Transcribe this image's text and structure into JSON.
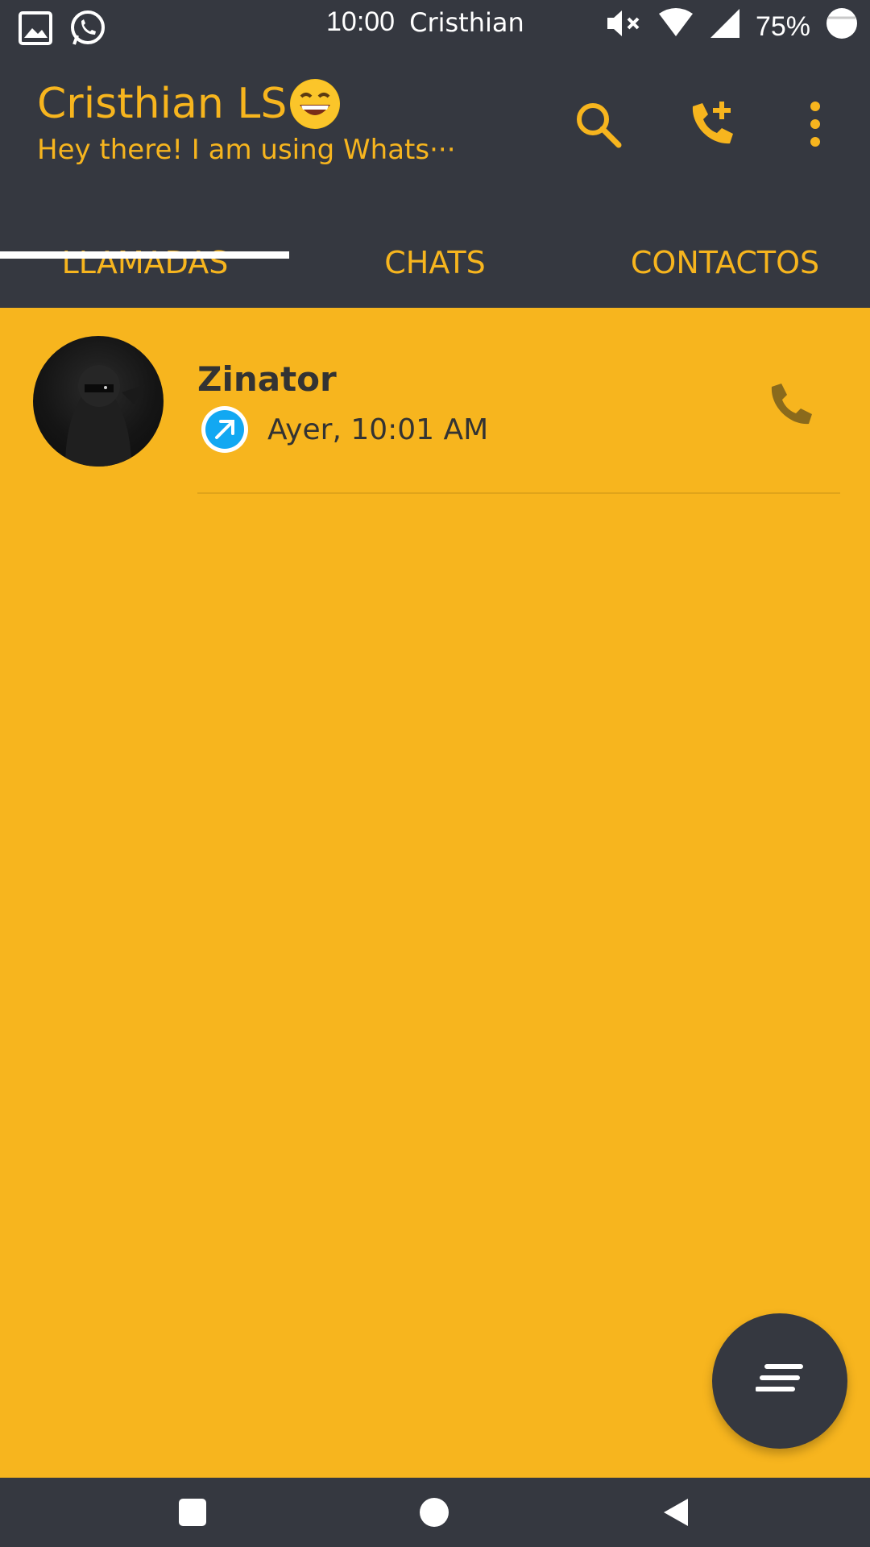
{
  "status_bar": {
    "time": "10:00",
    "carrier_name": "Cristhian",
    "battery": "75%",
    "icons": [
      "gallery-icon",
      "whatsapp-icon",
      "mute-icon",
      "wifi-icon",
      "signal-icon",
      "battery-icon"
    ]
  },
  "header": {
    "profile_name": "Cristhian LS",
    "status_text": "Hey there! I am using Whats···",
    "actions": [
      "search-icon",
      "add-call-icon",
      "more-vert-icon"
    ]
  },
  "tabs": [
    {
      "label": "LLAMADAS",
      "selected": true
    },
    {
      "label": "CHATS",
      "selected": false
    },
    {
      "label": "CONTACTOS",
      "selected": false
    }
  ],
  "calls": [
    {
      "name": "Zinator",
      "time": "Ayer, 10:01 AM",
      "direction": "outgoing"
    }
  ],
  "fab": {
    "icon": "sort-lines-icon"
  },
  "nav_bar": {
    "buttons": [
      "recents-square-icon",
      "home-circle-icon",
      "back-triangle-icon"
    ]
  },
  "colors": {
    "accent": "#f7b51e",
    "dark": "#353840",
    "outgoing_call": "#12a8f2"
  }
}
